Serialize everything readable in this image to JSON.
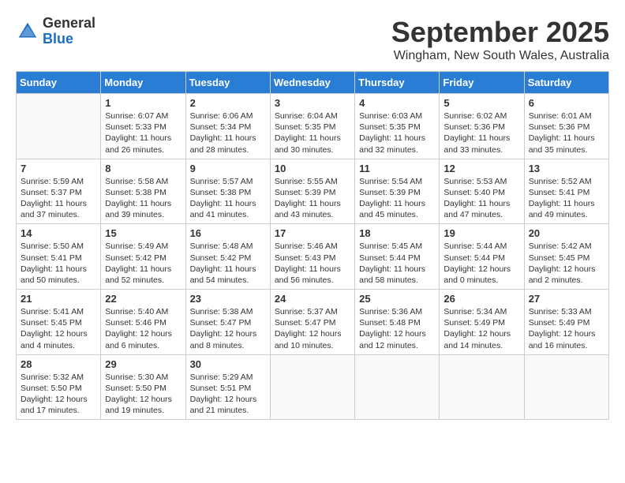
{
  "header": {
    "logo_general": "General",
    "logo_blue": "Blue",
    "month": "September 2025",
    "location": "Wingham, New South Wales, Australia"
  },
  "days_of_week": [
    "Sunday",
    "Monday",
    "Tuesday",
    "Wednesday",
    "Thursday",
    "Friday",
    "Saturday"
  ],
  "weeks": [
    [
      {
        "day": "",
        "info": ""
      },
      {
        "day": "1",
        "info": "Sunrise: 6:07 AM\nSunset: 5:33 PM\nDaylight: 11 hours\nand 26 minutes."
      },
      {
        "day": "2",
        "info": "Sunrise: 6:06 AM\nSunset: 5:34 PM\nDaylight: 11 hours\nand 28 minutes."
      },
      {
        "day": "3",
        "info": "Sunrise: 6:04 AM\nSunset: 5:35 PM\nDaylight: 11 hours\nand 30 minutes."
      },
      {
        "day": "4",
        "info": "Sunrise: 6:03 AM\nSunset: 5:35 PM\nDaylight: 11 hours\nand 32 minutes."
      },
      {
        "day": "5",
        "info": "Sunrise: 6:02 AM\nSunset: 5:36 PM\nDaylight: 11 hours\nand 33 minutes."
      },
      {
        "day": "6",
        "info": "Sunrise: 6:01 AM\nSunset: 5:36 PM\nDaylight: 11 hours\nand 35 minutes."
      }
    ],
    [
      {
        "day": "7",
        "info": "Sunrise: 5:59 AM\nSunset: 5:37 PM\nDaylight: 11 hours\nand 37 minutes."
      },
      {
        "day": "8",
        "info": "Sunrise: 5:58 AM\nSunset: 5:38 PM\nDaylight: 11 hours\nand 39 minutes."
      },
      {
        "day": "9",
        "info": "Sunrise: 5:57 AM\nSunset: 5:38 PM\nDaylight: 11 hours\nand 41 minutes."
      },
      {
        "day": "10",
        "info": "Sunrise: 5:55 AM\nSunset: 5:39 PM\nDaylight: 11 hours\nand 43 minutes."
      },
      {
        "day": "11",
        "info": "Sunrise: 5:54 AM\nSunset: 5:39 PM\nDaylight: 11 hours\nand 45 minutes."
      },
      {
        "day": "12",
        "info": "Sunrise: 5:53 AM\nSunset: 5:40 PM\nDaylight: 11 hours\nand 47 minutes."
      },
      {
        "day": "13",
        "info": "Sunrise: 5:52 AM\nSunset: 5:41 PM\nDaylight: 11 hours\nand 49 minutes."
      }
    ],
    [
      {
        "day": "14",
        "info": "Sunrise: 5:50 AM\nSunset: 5:41 PM\nDaylight: 11 hours\nand 50 minutes."
      },
      {
        "day": "15",
        "info": "Sunrise: 5:49 AM\nSunset: 5:42 PM\nDaylight: 11 hours\nand 52 minutes."
      },
      {
        "day": "16",
        "info": "Sunrise: 5:48 AM\nSunset: 5:42 PM\nDaylight: 11 hours\nand 54 minutes."
      },
      {
        "day": "17",
        "info": "Sunrise: 5:46 AM\nSunset: 5:43 PM\nDaylight: 11 hours\nand 56 minutes."
      },
      {
        "day": "18",
        "info": "Sunrise: 5:45 AM\nSunset: 5:44 PM\nDaylight: 11 hours\nand 58 minutes."
      },
      {
        "day": "19",
        "info": "Sunrise: 5:44 AM\nSunset: 5:44 PM\nDaylight: 12 hours\nand 0 minutes."
      },
      {
        "day": "20",
        "info": "Sunrise: 5:42 AM\nSunset: 5:45 PM\nDaylight: 12 hours\nand 2 minutes."
      }
    ],
    [
      {
        "day": "21",
        "info": "Sunrise: 5:41 AM\nSunset: 5:45 PM\nDaylight: 12 hours\nand 4 minutes."
      },
      {
        "day": "22",
        "info": "Sunrise: 5:40 AM\nSunset: 5:46 PM\nDaylight: 12 hours\nand 6 minutes."
      },
      {
        "day": "23",
        "info": "Sunrise: 5:38 AM\nSunset: 5:47 PM\nDaylight: 12 hours\nand 8 minutes."
      },
      {
        "day": "24",
        "info": "Sunrise: 5:37 AM\nSunset: 5:47 PM\nDaylight: 12 hours\nand 10 minutes."
      },
      {
        "day": "25",
        "info": "Sunrise: 5:36 AM\nSunset: 5:48 PM\nDaylight: 12 hours\nand 12 minutes."
      },
      {
        "day": "26",
        "info": "Sunrise: 5:34 AM\nSunset: 5:49 PM\nDaylight: 12 hours\nand 14 minutes."
      },
      {
        "day": "27",
        "info": "Sunrise: 5:33 AM\nSunset: 5:49 PM\nDaylight: 12 hours\nand 16 minutes."
      }
    ],
    [
      {
        "day": "28",
        "info": "Sunrise: 5:32 AM\nSunset: 5:50 PM\nDaylight: 12 hours\nand 17 minutes."
      },
      {
        "day": "29",
        "info": "Sunrise: 5:30 AM\nSunset: 5:50 PM\nDaylight: 12 hours\nand 19 minutes."
      },
      {
        "day": "30",
        "info": "Sunrise: 5:29 AM\nSunset: 5:51 PM\nDaylight: 12 hours\nand 21 minutes."
      },
      {
        "day": "",
        "info": ""
      },
      {
        "day": "",
        "info": ""
      },
      {
        "day": "",
        "info": ""
      },
      {
        "day": "",
        "info": ""
      }
    ]
  ]
}
